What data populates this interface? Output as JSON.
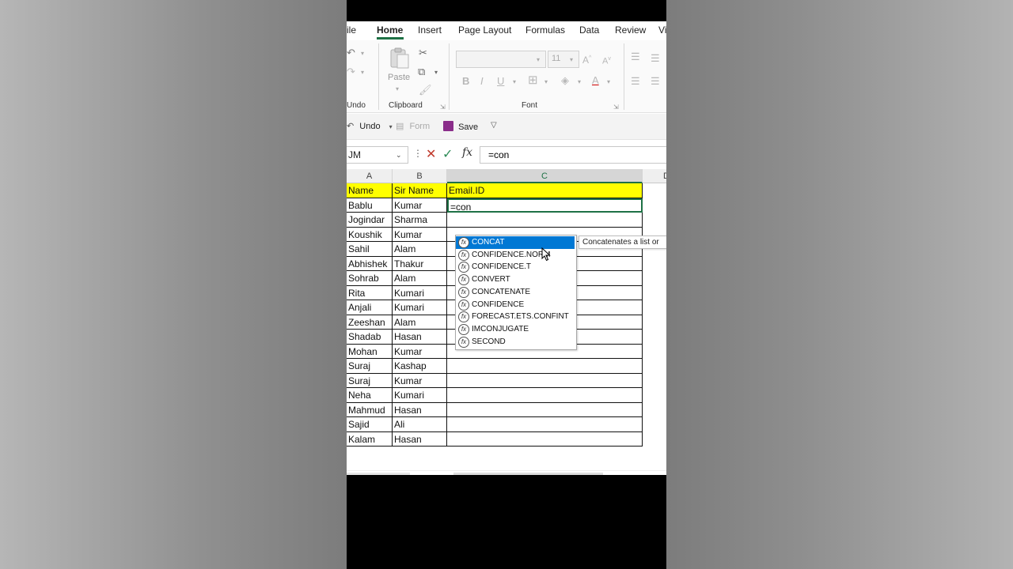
{
  "tabs": [
    "ile",
    "Home",
    "Insert",
    "Page Layout",
    "Formulas",
    "Data",
    "Review",
    "Vi"
  ],
  "ribbon": {
    "undo_group": "Undo",
    "clipboard_group": "Clipboard",
    "font_group": "Font",
    "paste_label": "Paste",
    "font_size": "11"
  },
  "qat": {
    "undo": "Undo",
    "form": "Form",
    "save": "Save"
  },
  "formula_bar": {
    "name_box": "JM",
    "fx_symbol": "fx",
    "content": "=con"
  },
  "columns": [
    "A",
    "B",
    "C",
    "D"
  ],
  "headers": {
    "a": "Name",
    "b": "Sir Name",
    "c": "Email.ID"
  },
  "rows": [
    {
      "a": "Bablu",
      "b": "Kumar",
      "c": "=con"
    },
    {
      "a": "Jogindar",
      "b": "Sharma",
      "c": ""
    },
    {
      "a": "Koushik",
      "b": "Kumar",
      "c": ""
    },
    {
      "a": "Sahil",
      "b": "Alam",
      "c": ""
    },
    {
      "a": "Abhishek",
      "b": "Thakur",
      "c": ""
    },
    {
      "a": "Sohrab",
      "b": "Alam",
      "c": ""
    },
    {
      "a": "Rita",
      "b": "Kumari",
      "c": ""
    },
    {
      "a": "Anjali",
      "b": "Kumari",
      "c": ""
    },
    {
      "a": "Zeeshan",
      "b": "Alam",
      "c": ""
    },
    {
      "a": "Shadab",
      "b": "Hasan",
      "c": ""
    },
    {
      "a": "Mohan",
      "b": "Kumar",
      "c": ""
    },
    {
      "a": "Suraj",
      "b": "Kashap",
      "c": ""
    },
    {
      "a": "Suraj",
      "b": "Kumar",
      "c": ""
    },
    {
      "a": "Neha",
      "b": "Kumari",
      "c": ""
    },
    {
      "a": "Mahmud",
      "b": "Hasan",
      "c": ""
    },
    {
      "a": "Sajid",
      "b": "Ali",
      "c": ""
    },
    {
      "a": "Kalam",
      "b": "Hasan",
      "c": ""
    }
  ],
  "autocomplete": {
    "items": [
      "CONCAT",
      "CONFIDENCE.NORM",
      "CONFIDENCE.T",
      "CONVERT",
      "CONCATENATE",
      "CONFIDENCE",
      "FORECAST.ETS.CONFINT",
      "IMCONJUGATE",
      "SECOND"
    ],
    "selected_index": 0,
    "tooltip": "Concatenates a list or"
  },
  "colors": {
    "accent": "#1e7145",
    "header_fill": "#ffff00",
    "selection": "#0078d4"
  }
}
